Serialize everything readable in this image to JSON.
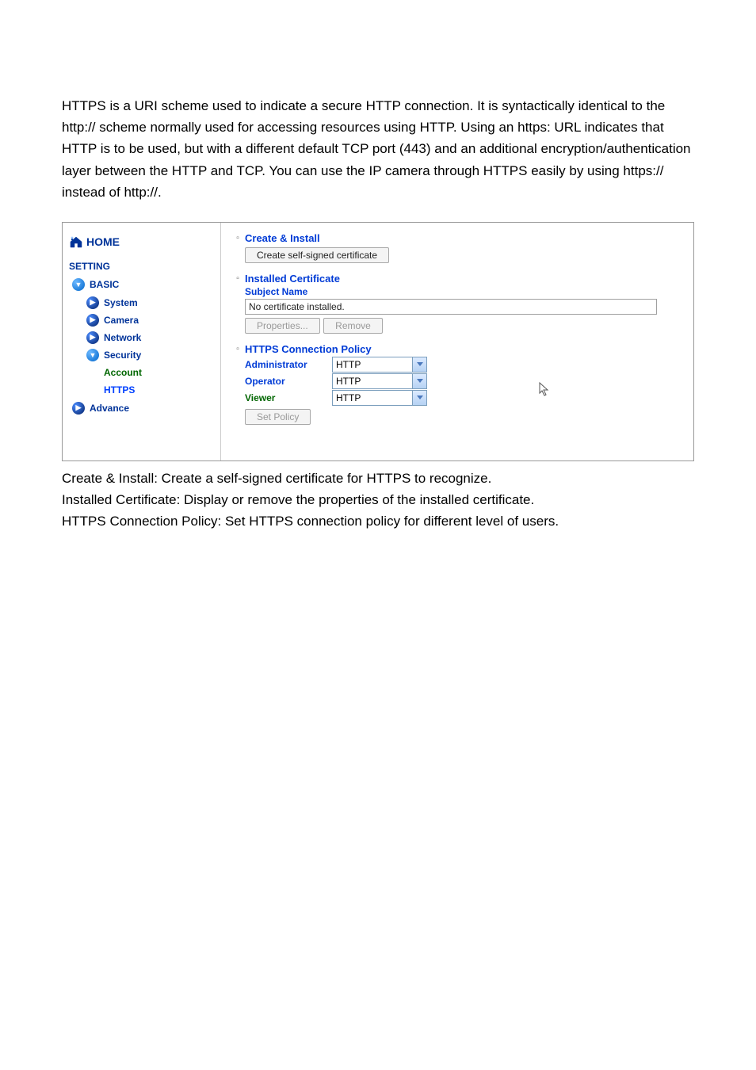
{
  "intro_paragraph": "HTTPS is a URI scheme used to indicate a secure HTTP connection. It is syntactically identical to the http:// scheme normally used for accessing resources using HTTP. Using an https: URL indicates that HTTP is to be used, but with a different default TCP port (443) and an additional encryption/authentication layer between the HTTP and TCP. You can use the IP camera through HTTPS easily by using https:// instead of http://.",
  "sidebar": {
    "home_label": "HOME",
    "setting_label": "SETTING",
    "basic_label": "BASIC",
    "items": {
      "system": "System",
      "camera": "Camera",
      "network": "Network",
      "security": "Security",
      "account": "Account",
      "https": "HTTPS",
      "advance": "Advance"
    }
  },
  "sections": {
    "create_install": {
      "title": "Create & Install",
      "button": "Create self-signed certificate"
    },
    "installed_cert": {
      "title": "Installed Certificate",
      "subject_name_label": "Subject Name",
      "status": "No certificate installed.",
      "properties_btn": "Properties...",
      "remove_btn": "Remove"
    },
    "https_policy": {
      "title": "HTTPS Connection Policy",
      "rows": {
        "administrator_label": "Administrator",
        "administrator_value": "HTTP",
        "operator_label": "Operator",
        "operator_value": "HTTP",
        "viewer_label": "Viewer",
        "viewer_value": "HTTP"
      },
      "set_policy_btn": "Set Policy"
    }
  },
  "descriptions": {
    "line1": "Create & Install: Create a self-signed certificate for HTTPS to recognize.",
    "line2": "Installed Certificate: Display or remove the properties of the installed certificate.",
    "line3": "HTTPS Connection Policy: Set HTTPS connection policy for different level of users."
  }
}
